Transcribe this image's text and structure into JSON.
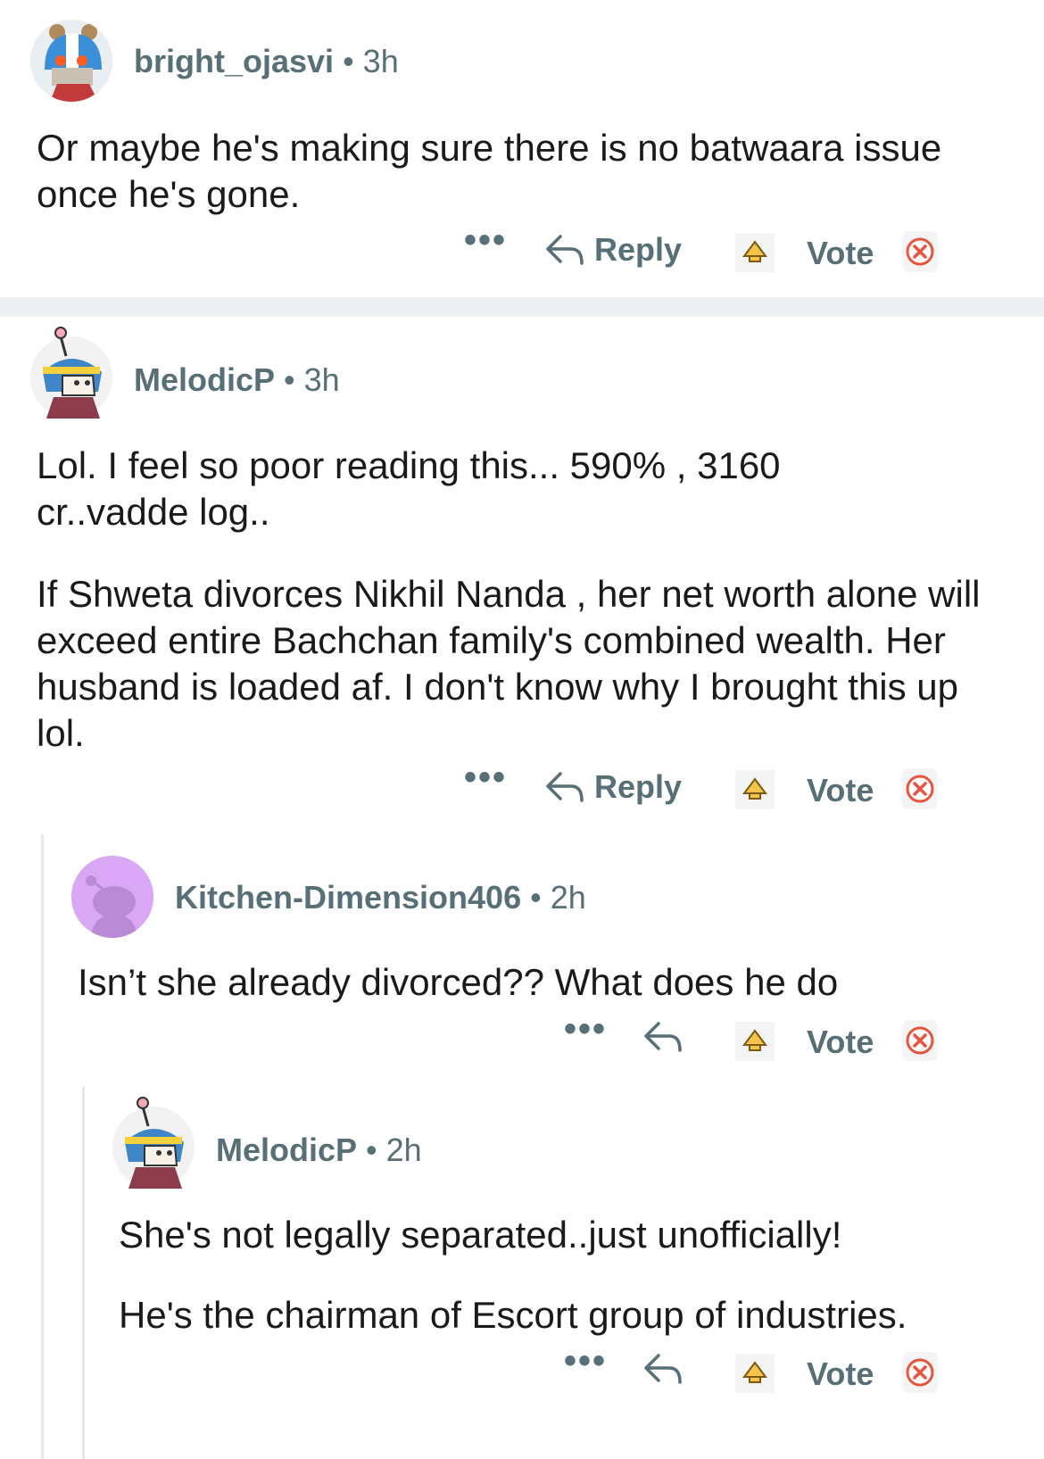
{
  "comments": [
    {
      "user": "bright_ojasvi",
      "time": "3h",
      "paragraphs": [
        "Or maybe he's making sure there is no batwaara issue once he's gone."
      ],
      "more": "•••",
      "reply_label": "Reply",
      "vote_label": "Vote"
    },
    {
      "user": "MelodicP",
      "time": "3h",
      "paragraphs": [
        "Lol. I feel so poor reading this... 590% , 3160 cr..vadde log..",
        "If Shweta divorces Nikhil Nanda , her net worth alone will exceed entire Bachchan family's combined wealth. Her husband is loaded af. I don't know why I brought this up lol."
      ],
      "more": "•••",
      "reply_label": "Reply",
      "vote_label": "Vote"
    },
    {
      "user": "Kitchen-Dimension406",
      "time": "2h",
      "paragraphs": [
        "Isn’t she already divorced?? What does he do"
      ],
      "more": "•••",
      "vote_label": "Vote"
    },
    {
      "user": "MelodicP",
      "time": "2h",
      "paragraphs": [
        "She's not legally separated..just unofficially!",
        "He's the chairman of Escort group of industries."
      ],
      "more": "•••",
      "vote_label": "Vote"
    }
  ],
  "separator": "•",
  "colors": {
    "meta": "#576f76",
    "text": "#1a1a1b",
    "downvote": "#e8543f",
    "award": "#f5c44a",
    "divider": "#eeeff0"
  }
}
